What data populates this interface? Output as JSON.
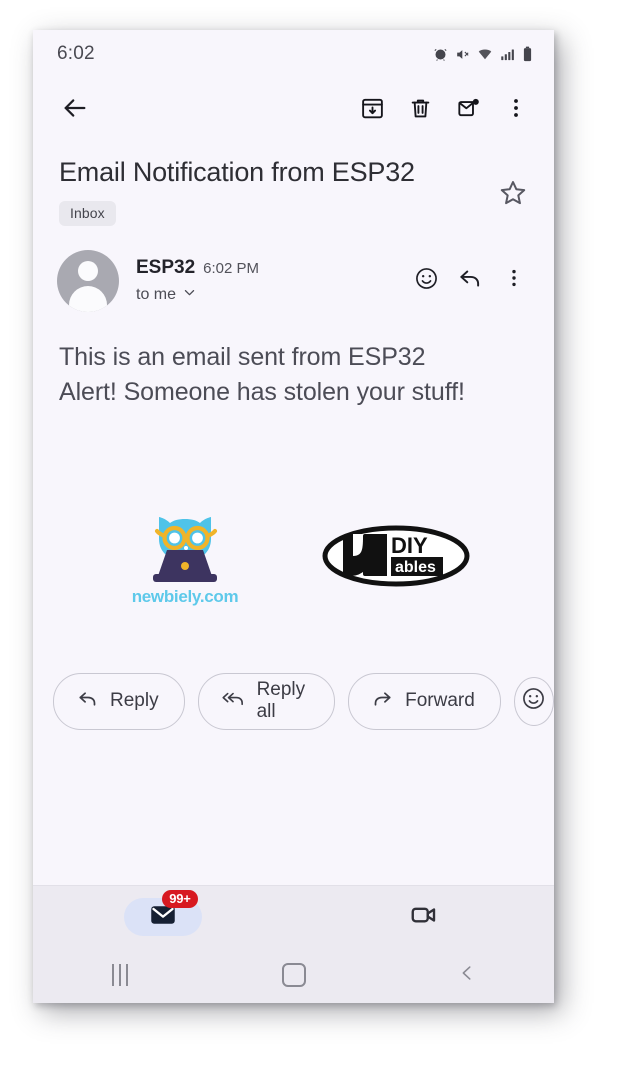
{
  "status_bar": {
    "time": "6:02",
    "icons": [
      "alarm-icon",
      "mute-icon",
      "wifi-icon",
      "cellular-signal-icon",
      "battery-icon"
    ]
  },
  "toolbar": {
    "back_icon": "back-arrow-icon",
    "archive_icon": "archive-icon",
    "delete_icon": "trash-icon",
    "mark_unread_icon": "mark-unread-icon",
    "overflow_icon": "more-vert-icon"
  },
  "subject": {
    "title": "Email Notification from ESP32",
    "chip_label": "Inbox",
    "star_icon": "star-outline-icon"
  },
  "sender": {
    "avatar_icon": "person-avatar",
    "name": "ESP32",
    "time": "6:02 PM",
    "recipient": "to me",
    "expand_icon": "chevron-down-icon",
    "emoji_icon": "emoji-smile-icon",
    "reply_icon": "reply-arrow-icon",
    "overflow_icon": "more-vert-icon"
  },
  "body": {
    "line1": "This is an email sent from ESP32",
    "line2": "Alert! Someone has stolen your stuff!"
  },
  "logos": {
    "newbiely": {
      "name": "newbiely-logo",
      "caption": "newbiely.com",
      "owl_color": "#4fc3e8",
      "glasses_color": "#f0b429",
      "laptop_color": "#3d3460",
      "caption_color": "#5ec9ea"
    },
    "diyables": {
      "name": "diyables-logo",
      "text_top": "DIY",
      "text_bottom": "ables"
    }
  },
  "actions": {
    "reply": {
      "label": "Reply",
      "icon": "reply-arrow-icon"
    },
    "reply_all": {
      "label": "Reply all",
      "icon": "reply-all-arrow-icon"
    },
    "forward": {
      "label": "Forward",
      "icon": "forward-arrow-icon"
    },
    "emoji": {
      "icon": "emoji-smile-icon"
    }
  },
  "bottom_nav": {
    "mail_tab": {
      "name": "mail-tab",
      "icon": "mail-icon",
      "badge": "99+",
      "badge_color": "#d71921",
      "selected": true
    },
    "meet_tab": {
      "name": "meet-tab",
      "icon": "video-camera-icon",
      "selected": false
    }
  },
  "system_nav": {
    "recents_icon": "recents-icon",
    "home_icon": "home-icon",
    "back_icon": "system-back-icon"
  }
}
